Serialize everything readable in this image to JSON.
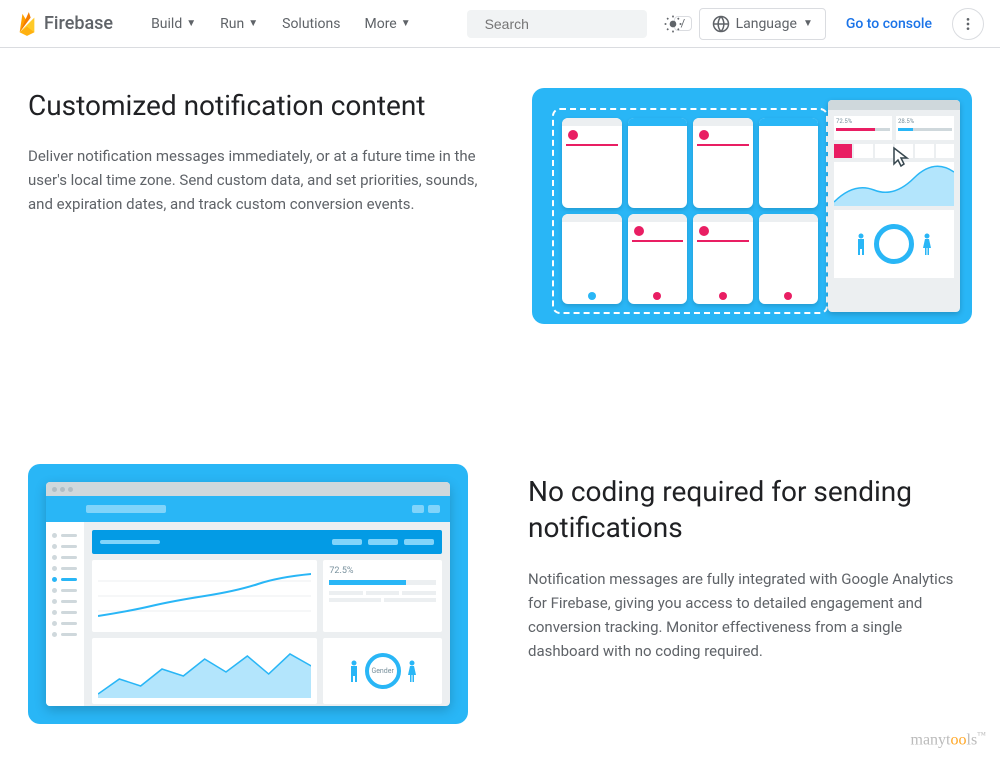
{
  "header": {
    "brand": "Firebase",
    "nav": {
      "build": "Build",
      "run": "Run",
      "solutions": "Solutions",
      "more": "More"
    },
    "search_placeholder": "Search",
    "search_kbd": "/",
    "language_label": "Language",
    "console_link": "Go to console"
  },
  "section1": {
    "title": "Customized notification content",
    "description": "Deliver notification messages immediately, or at a future time in the user's local time zone. Send custom data, and set priorities, sounds, and expiration dates, and track custom conversion events."
  },
  "section2": {
    "title": "No coding required for sending notifications",
    "description": "Notification messages are fully integrated with Google Analytics for Firebase, giving you access to detailed engagement and conversion tracking. Monitor effectiveness from a single dashboard with no coding required."
  },
  "dashboard": {
    "stat_a": "72.5%",
    "stat_b": "28.5%",
    "gender_label": "Gender"
  },
  "watermark": {
    "pre": "manyt",
    "mid": "o",
    "mid2": "o",
    "post": "ls",
    "tm": "™"
  }
}
